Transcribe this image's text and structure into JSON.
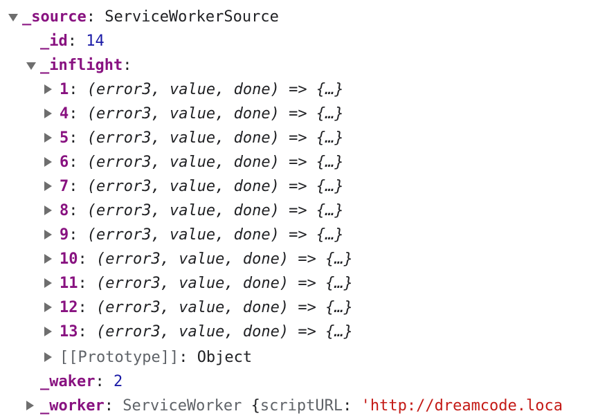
{
  "tree": {
    "source": {
      "key": "_source",
      "value": "ServiceWorkerSource"
    },
    "id": {
      "key": "_id",
      "value": "14"
    },
    "inflight": {
      "key": "_inflight",
      "items": [
        {
          "key": "1",
          "value": "(error3, value, done) => {…}"
        },
        {
          "key": "4",
          "value": "(error3, value, done) => {…}"
        },
        {
          "key": "5",
          "value": "(error3, value, done) => {…}"
        },
        {
          "key": "6",
          "value": "(error3, value, done) => {…}"
        },
        {
          "key": "7",
          "value": "(error3, value, done) => {…}"
        },
        {
          "key": "8",
          "value": "(error3, value, done) => {…}"
        },
        {
          "key": "9",
          "value": "(error3, value, done) => {…}"
        },
        {
          "key": "10",
          "value": "(error3, value, done) => {…}"
        },
        {
          "key": "11",
          "value": "(error3, value, done) => {…}"
        },
        {
          "key": "12",
          "value": "(error3, value, done) => {…}"
        },
        {
          "key": "13",
          "value": "(error3, value, done) => {…}"
        }
      ],
      "prototype": {
        "key": "[[Prototype]]",
        "value": "Object"
      }
    },
    "waker": {
      "key": "_waker",
      "value": "2"
    },
    "worker": {
      "key": "_worker",
      "type": "ServiceWorker",
      "prop_key": "scriptURL",
      "prop_value": "'http://dreamcode.loca"
    }
  }
}
